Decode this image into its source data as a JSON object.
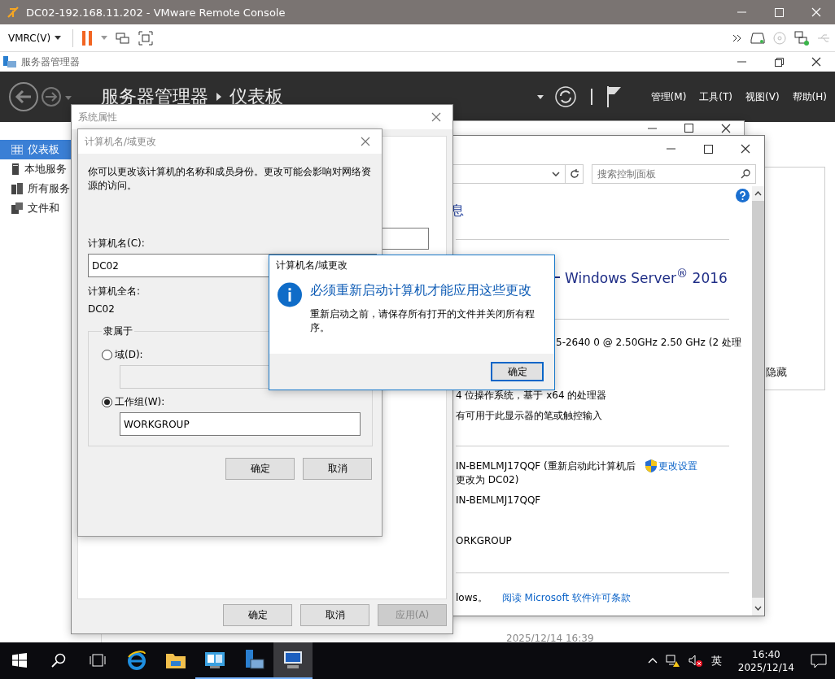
{
  "vmrc": {
    "title": "DC02-192.168.11.202 - VMware Remote Console",
    "menu": "VMRC(V)"
  },
  "server_manager": {
    "title": "服务器管理器",
    "breadcrumb": "服务器管理器",
    "page": "仪表板",
    "menus": [
      "管理(M)",
      "工具(T)",
      "视图(V)",
      "帮助(H)"
    ],
    "sidebar": [
      {
        "label": "仪表板",
        "selected": true,
        "kind": "dashboard"
      },
      {
        "label": "本地服务",
        "selected": false,
        "kind": "server"
      },
      {
        "label": "所有服务",
        "selected": false,
        "kind": "servers"
      },
      {
        "label": "文件和",
        "selected": false,
        "kind": "files"
      }
    ],
    "hide_label": "隐藏",
    "timestamp": "2025/12/14 16:39"
  },
  "system_window": {
    "search": {
      "placeholder": "搜索控制面板"
    },
    "heading": "息",
    "edition": "Windows Server$^{®}$ 2016",
    "cpu": "5-2640 0 @ 2.50GHz   2.50 GHz  (2 处理",
    "os_type": "4 位操作系统，基于 x64 的处理器",
    "pen": "有可用于此显示器的笔或触控输入",
    "computer_name": [
      "IN-BEMLMJ17QQF (重新启动此计算机后",
      "更改为 DC02)"
    ],
    "change_link": "更改设置",
    "full_name": "IN-BEMLMJ17QQF",
    "workgroup": "ORKGROUP",
    "footer_text": "lows。",
    "license_link": "阅读 Microsoft 软件许可条款"
  },
  "system_properties": {
    "title": "系统属性",
    "buttons": [
      {
        "label": "确定",
        "disabled": false
      },
      {
        "label": "取消",
        "disabled": false
      },
      {
        "label": "应用(A)",
        "disabled": true
      }
    ]
  },
  "name_dialog": {
    "title": "计算机名/域更改",
    "description": "你可以更改该计算机的名称和成员身份。更改可能会影响对网络资源的访问。",
    "name_label": "计算机名(C):",
    "name_value": "DC02",
    "full_name_label": "计算机全名:",
    "full_name": "DC02",
    "member_of": "隶属于",
    "options": [
      {
        "label": "域(D):",
        "selected": false
      },
      {
        "label": "工作组(W):",
        "selected": true,
        "value": "WORKGROUP"
      }
    ],
    "buttons": [
      "确定",
      "取消"
    ]
  },
  "message": {
    "title": "计算机名/域更改",
    "heading": "必须重新启动计算机才能应用这些更改",
    "body": "重新启动之前，请保存所有打开的文件并关闭所有程序。",
    "button": "确定"
  },
  "taskbar": {
    "apps": [
      {
        "kind": "browser",
        "active": false,
        "running": false
      },
      {
        "kind": "folder",
        "active": false,
        "running": false
      },
      {
        "kind": "panel",
        "active": false,
        "running": true
      },
      {
        "kind": "server",
        "active": false,
        "running": true
      },
      {
        "kind": "remote",
        "active": true,
        "running": true
      }
    ],
    "ime": "英",
    "time": "16:40",
    "date": "2025/12/14"
  }
}
